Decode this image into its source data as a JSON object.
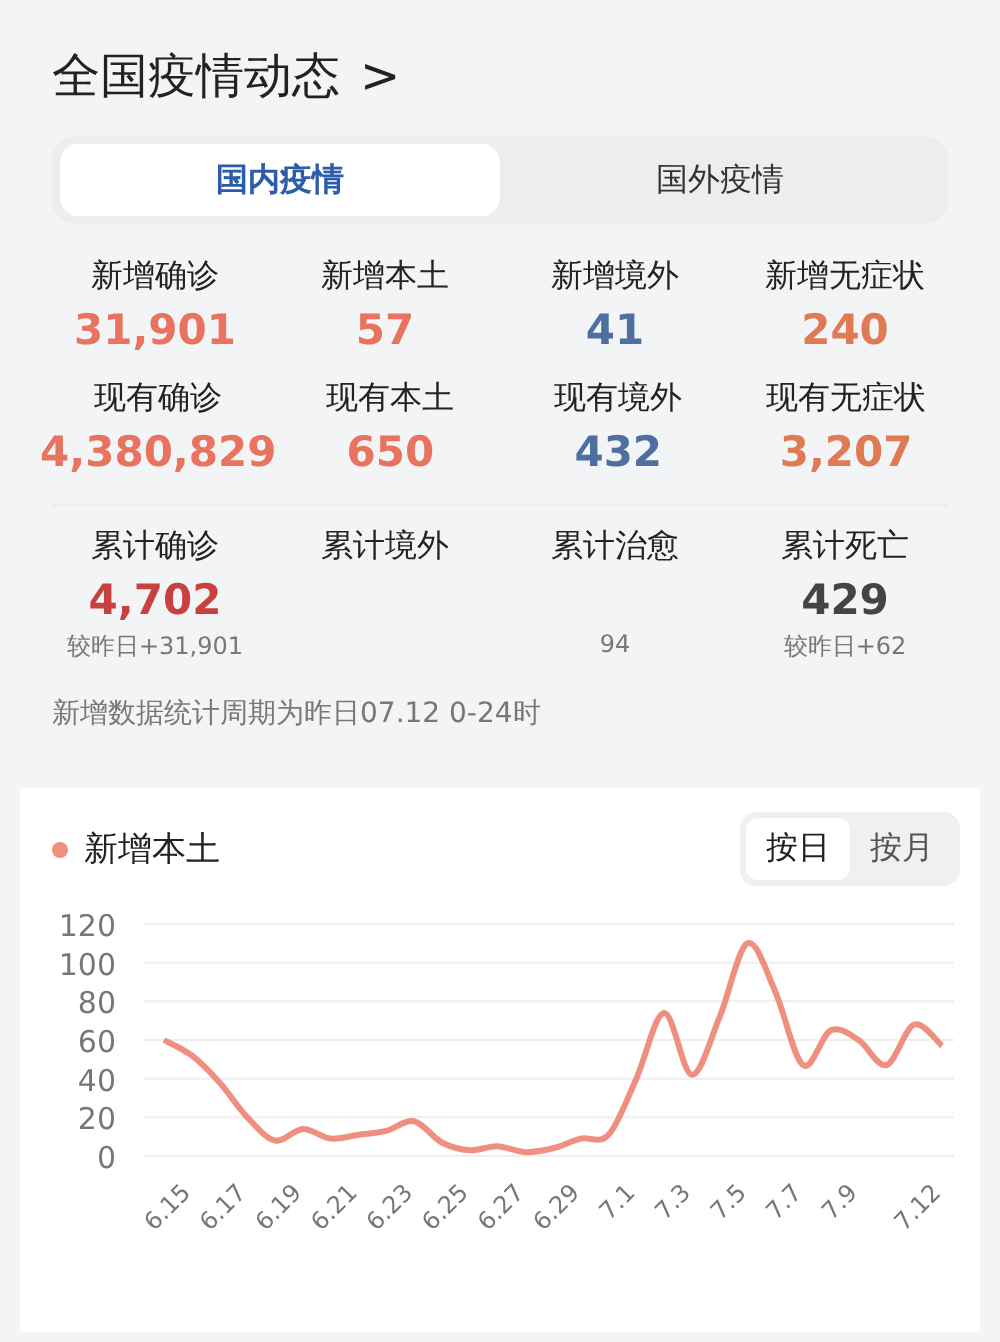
{
  "title": "全国疫情动态",
  "title_arrow": ">",
  "tabs": [
    {
      "label": "国内疫情",
      "selected": true
    },
    {
      "label": "国外疫情",
      "selected": false
    }
  ],
  "stat_groups": [
    {
      "items": [
        {
          "label": "新增确诊",
          "value": "31,901",
          "color": "#e8735e"
        },
        {
          "label": "新增本土",
          "value": "57",
          "color": "#e8735e"
        },
        {
          "label": "新增境外",
          "value": "41",
          "color": "#4f6fa0"
        },
        {
          "label": "新增无症状",
          "value": "240",
          "color": "#e07a55"
        }
      ]
    },
    {
      "items": [
        {
          "label": "现有确诊",
          "value": "4,380,829",
          "color": "#e8735e"
        },
        {
          "label": "现有本土",
          "value": "650",
          "color": "#e8735e"
        },
        {
          "label": "现有境外",
          "value": "432",
          "color": "#4f6fa0"
        },
        {
          "label": "现有无症状",
          "value": "3,207",
          "color": "#e07a55"
        }
      ]
    },
    {
      "items": [
        {
          "label": "累计确诊",
          "value": "4,702",
          "delta": "较昨日+31,901",
          "color": "#c94040"
        },
        {
          "label": "累计境外"
        },
        {
          "label": "累计治愈",
          "delta": "94"
        },
        {
          "label": "累计死亡",
          "value": "429",
          "delta": "较昨日+62",
          "color": "#444444"
        }
      ]
    }
  ],
  "note": "新增数据统计周期为昨日07.12 0-24时",
  "chart_panel": {
    "legend": "新增本土",
    "toggle": [
      {
        "label": "按日",
        "selected": true
      },
      {
        "label": "按月",
        "selected": false
      }
    ],
    "chart_data": {
      "type": "line",
      "grid": true,
      "categories": [
        null,
        "6.15",
        null,
        "6.17",
        null,
        "6.19",
        null,
        "6.21",
        null,
        "6.23",
        null,
        "6.25",
        null,
        "6.27",
        null,
        "6.29",
        null,
        "7.1",
        null,
        "7.3",
        null,
        "7.5",
        null,
        "7.7",
        null,
        "7.9",
        null,
        null,
        "7.12"
      ],
      "series": [
        {
          "color": "#ef8f7f",
          "values": [
            60,
            52,
            38,
            20,
            8,
            14,
            9,
            11,
            13,
            18,
            7,
            3,
            5,
            2,
            4,
            9,
            11,
            40,
            74,
            42,
            72,
            110,
            85,
            47,
            65,
            60,
            47,
            68,
            57
          ]
        }
      ],
      "ylim": [
        0,
        120
      ],
      "yticks": [
        0,
        20,
        40,
        60,
        80,
        100,
        120
      ]
    }
  }
}
